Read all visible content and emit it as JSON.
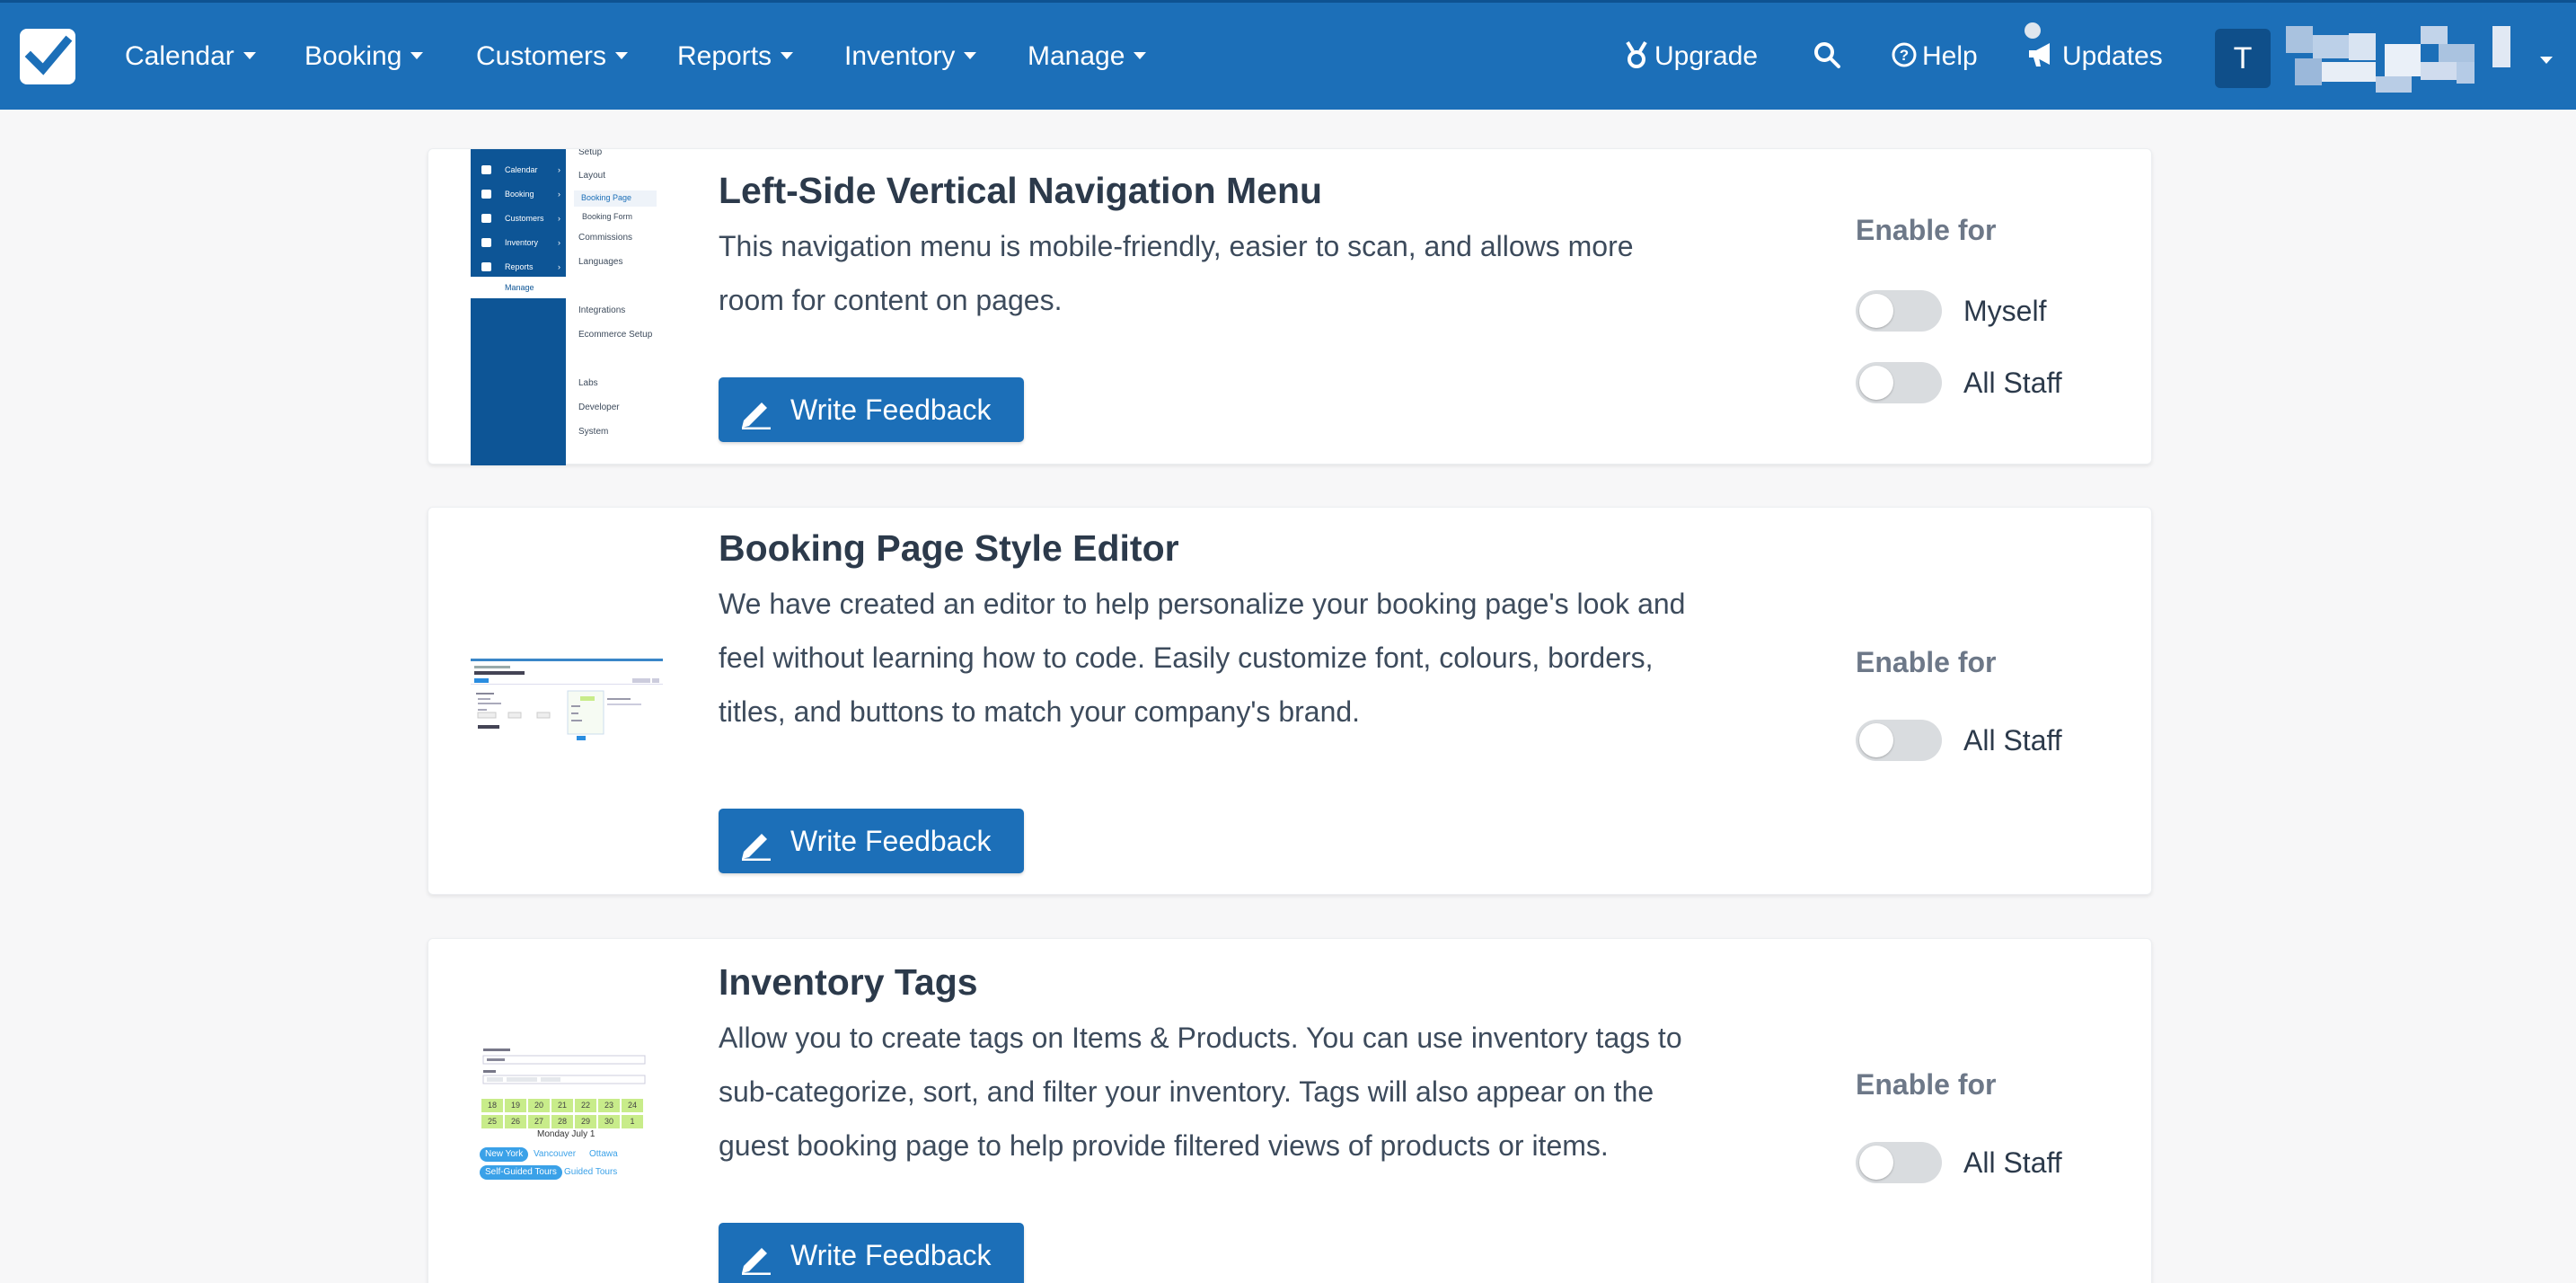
{
  "nav": {
    "menu": [
      "Calendar",
      "Booking",
      "Customers",
      "Reports",
      "Inventory",
      "Manage"
    ],
    "upgrade": "Upgrade",
    "help": "Help",
    "updates": "Updates",
    "avatar_initial": "T"
  },
  "features": [
    {
      "title": "Left-Side Vertical Navigation Menu",
      "description": "This navigation menu is mobile-friendly, easier to scan, and allows more room for content on pages.",
      "button": "Write Feedback",
      "enable_label": "Enable for",
      "toggles": [
        {
          "label": "Myself",
          "on": false
        },
        {
          "label": "All Staff",
          "on": false
        }
      ]
    },
    {
      "title": "Booking Page Style Editor",
      "description": "We have created an editor to help personalize your booking page's look and feel without learning how to code. Easily customize font, colours, borders, titles, and buttons to match your company's brand.",
      "button": "Write Feedback",
      "enable_label": "Enable for",
      "toggles": [
        {
          "label": "All Staff",
          "on": false
        }
      ]
    },
    {
      "title": "Inventory Tags",
      "description": "Allow you to create tags on Items & Products. You can use inventory tags to sub-categorize, sort, and filter your inventory. Tags will also appear on the guest booking page to help provide filtered views of products or items.",
      "button": "Write Feedback",
      "enable_label": "Enable for",
      "toggles": [
        {
          "label": "All Staff",
          "on": false
        }
      ]
    }
  ],
  "thumb_nav": {
    "side": [
      "Calendar",
      "Booking",
      "Customers",
      "Inventory",
      "Reports"
    ],
    "manage": "Manage",
    "sub": [
      "Setup",
      "Layout",
      "Booking Page",
      "Booking Form",
      "Commissions",
      "Languages",
      "Integrations",
      "Ecommerce Setup",
      "Labs",
      "Developer",
      "System"
    ]
  },
  "thumb_tags": {
    "days_row1": [
      "18",
      "19",
      "20",
      "21",
      "22",
      "23",
      "24"
    ],
    "days_row2": [
      "25",
      "26",
      "27",
      "28",
      "29",
      "30",
      "1"
    ],
    "date_label": "Monday July 1",
    "tags_row1": [
      "New York",
      "Vancouver",
      "Ottawa"
    ],
    "tags_row2": [
      "Self-Guided Tours",
      "Guided Tours"
    ]
  },
  "colors": {
    "nav_bg": "#1c6fb8",
    "button_bg": "#1c6fb8",
    "toggle_off": "#d9dcdf"
  }
}
